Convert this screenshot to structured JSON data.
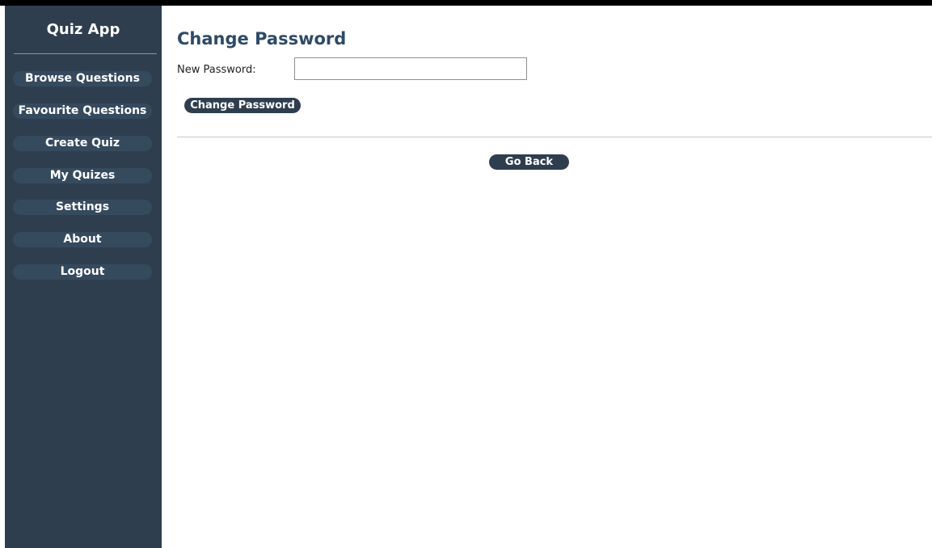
{
  "sidebar": {
    "brand": "Quiz App",
    "items": [
      {
        "label": "Browse Questions"
      },
      {
        "label": "Favourite Questions"
      },
      {
        "label": "Create Quiz"
      },
      {
        "label": "My Quizes"
      },
      {
        "label": "Settings"
      },
      {
        "label": "About"
      },
      {
        "label": "Logout"
      }
    ]
  },
  "main": {
    "title": "Change Password",
    "form": {
      "new_password_label": "New Password:",
      "new_password_value": "",
      "submit_label": "Change Password"
    },
    "go_back_label": "Go Back"
  },
  "colors": {
    "sidebar_bg": "#2f3e4f",
    "sidebar_item_bg": "#364a5e",
    "title_text": "#2f4a68",
    "button_bg": "#2f3e4f"
  }
}
